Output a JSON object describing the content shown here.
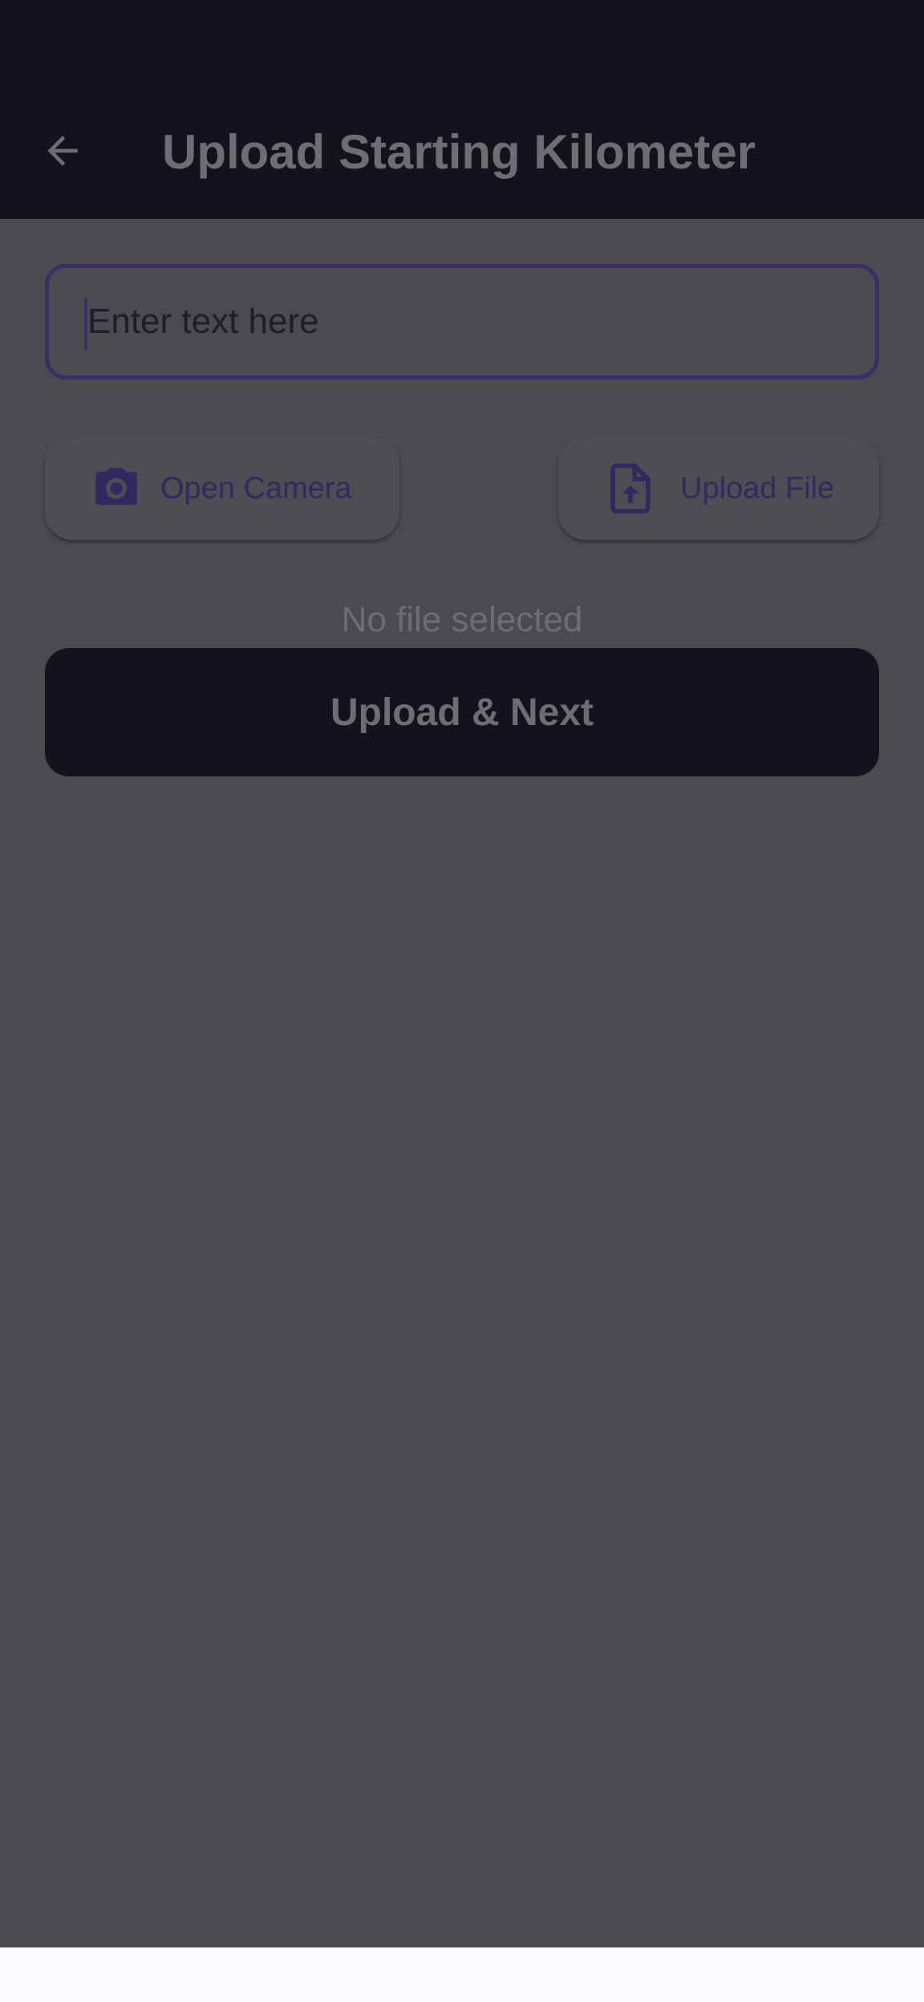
{
  "appbar": {
    "back_icon": "arrow-left-icon",
    "title": "Upload Starting Kilometer"
  },
  "form": {
    "text_field": {
      "placeholder": "Enter text here",
      "value": ""
    },
    "camera_button": {
      "label": "Open Camera",
      "icon": "camera-icon"
    },
    "file_button": {
      "label": "Upload File",
      "icon": "file-upload-icon"
    },
    "status_text": "No file selected",
    "submit_label": "Upload & Next"
  },
  "colors": {
    "appbar_bg": "#13131e",
    "overlay_bg": "#4b4a4f",
    "accent": "#3a2d68",
    "button_text": "#33295e"
  }
}
